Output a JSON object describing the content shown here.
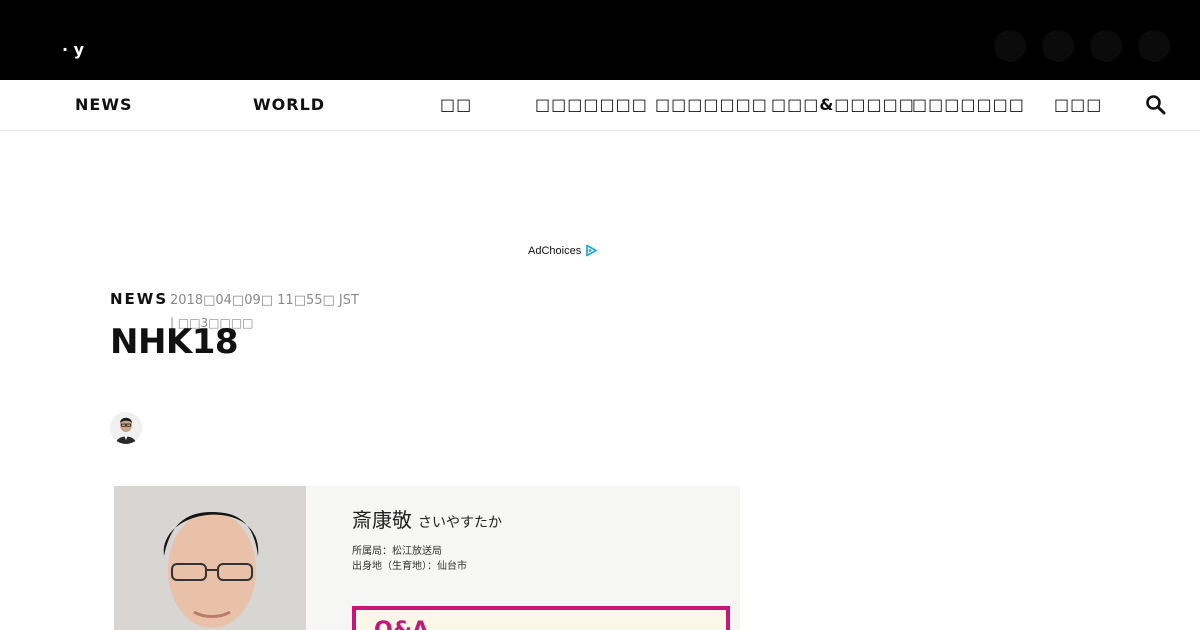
{
  "header": {
    "logo_fragment": "· y"
  },
  "nav": {
    "items": [
      {
        "label": "NEWS"
      },
      {
        "label": "WORLD"
      },
      {
        "label": "□□"
      },
      {
        "label": "□□□□□□□"
      },
      {
        "label": "□□□□□□□"
      },
      {
        "label": "□□□&□□□□□"
      },
      {
        "label": "□□□□□□□"
      },
      {
        "label": "□□□"
      }
    ]
  },
  "ad": {
    "label": "AdChoices",
    "accent": "#22a7d8"
  },
  "article": {
    "category": "NEWS",
    "date": "2018□04□09□ 11□55□ JST",
    "author": "| □□3□□□□",
    "title": "NHK18",
    "image": {
      "name": "斎康敬",
      "kana": "さいやすたか",
      "line1": "所属局：松江放送局",
      "line2": "出身地（生育地）：仙台市",
      "box_text": "Q&A",
      "box_color": "#c5177a"
    }
  }
}
